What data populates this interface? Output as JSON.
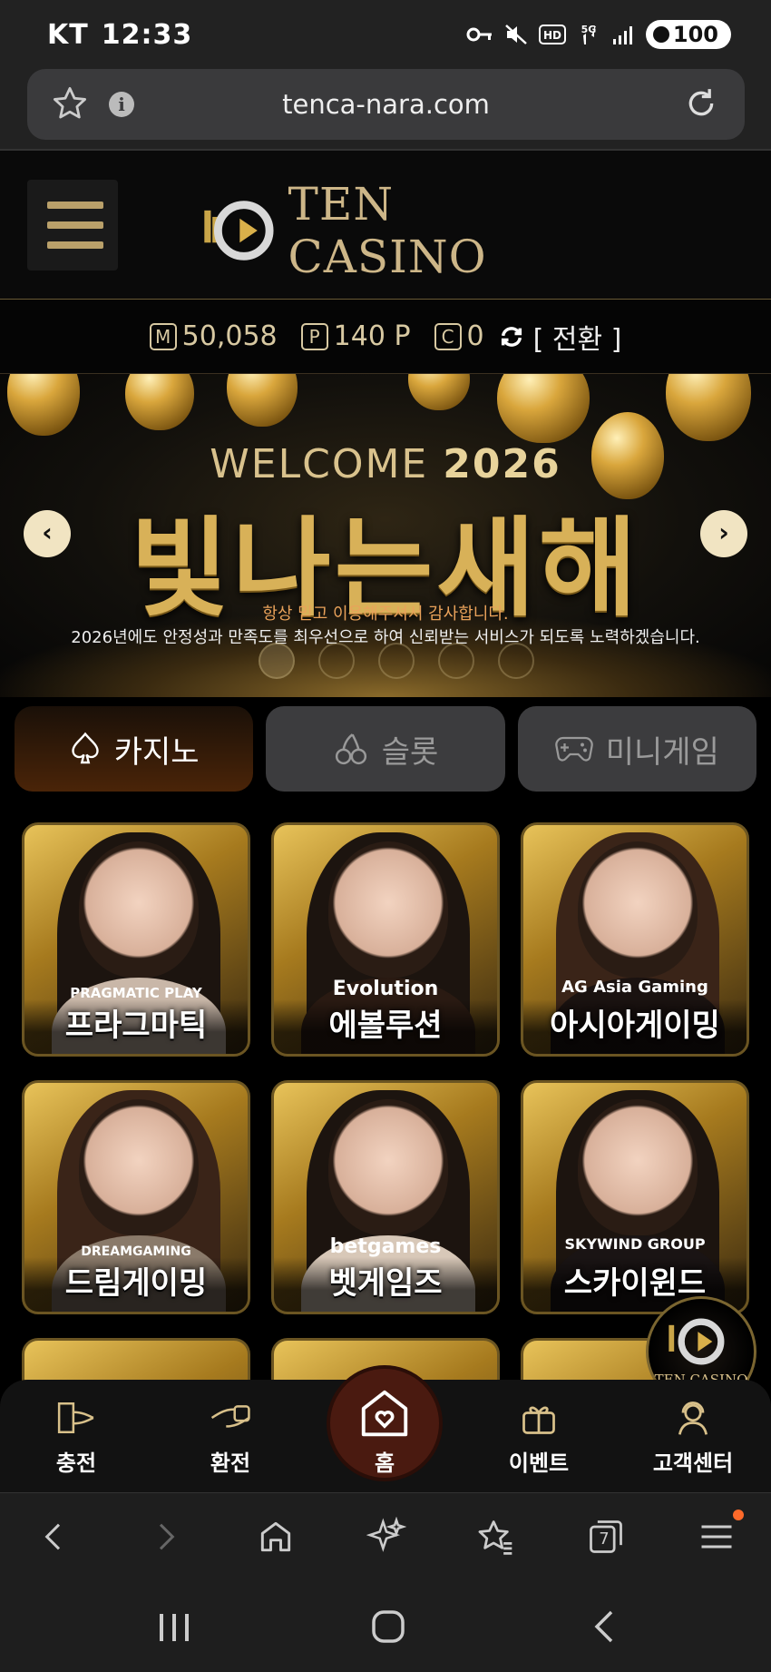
{
  "status_bar": {
    "carrier": "KT",
    "time": "12:33",
    "battery": "100",
    "network": "5G"
  },
  "browser": {
    "url": "tenca-nara.com"
  },
  "site": {
    "logo_text": "TEN CASINO"
  },
  "balance": {
    "money_icon": "M",
    "money": "50,058",
    "point_icon": "P",
    "points": "140 P",
    "coupon_icon": "C",
    "coupons": "0",
    "convert_label": "[ 전환 ]"
  },
  "banner": {
    "welcome": "WELCOME",
    "year": "2026",
    "headline": "빛나는새해",
    "sub1": "항상 믿고 이용해주셔서 감사합니다.",
    "sub2": "2026년에도 안정성과 만족도를 최우선으로 하여 신뢰받는 서비스가 되도록 노력하겠습니다."
  },
  "tabs": [
    {
      "label": "카지노",
      "icon": "spade-icon",
      "active": true
    },
    {
      "label": "슬롯",
      "icon": "cherry-icon",
      "active": false
    },
    {
      "label": "미니게임",
      "icon": "gamepad-icon",
      "active": false
    }
  ],
  "games": [
    {
      "name": "프라그마틱",
      "brand": "PRAGMATIC PLAY"
    },
    {
      "name": "에볼루션",
      "brand": "Evolution"
    },
    {
      "name": "아시아게이밍",
      "brand": "AG Asia Gaming"
    },
    {
      "name": "드림게이밍",
      "brand": "DREAMGAMING"
    },
    {
      "name": "벳게임즈",
      "brand": "betgames"
    },
    {
      "name": "스카이윈드",
      "brand": "SKYWIND GROUP"
    }
  ],
  "float_logo": "TEN CASINO",
  "bottom_nav": {
    "charge": "충전",
    "exchange": "환전",
    "home": "홈",
    "event": "이벤트",
    "support": "고객센터"
  },
  "browser_toolbar": {
    "tabs_count": "7"
  },
  "colors": {
    "gold": "#d8b158",
    "active_tab": "#4a2408",
    "nav_bg": "#121212"
  }
}
